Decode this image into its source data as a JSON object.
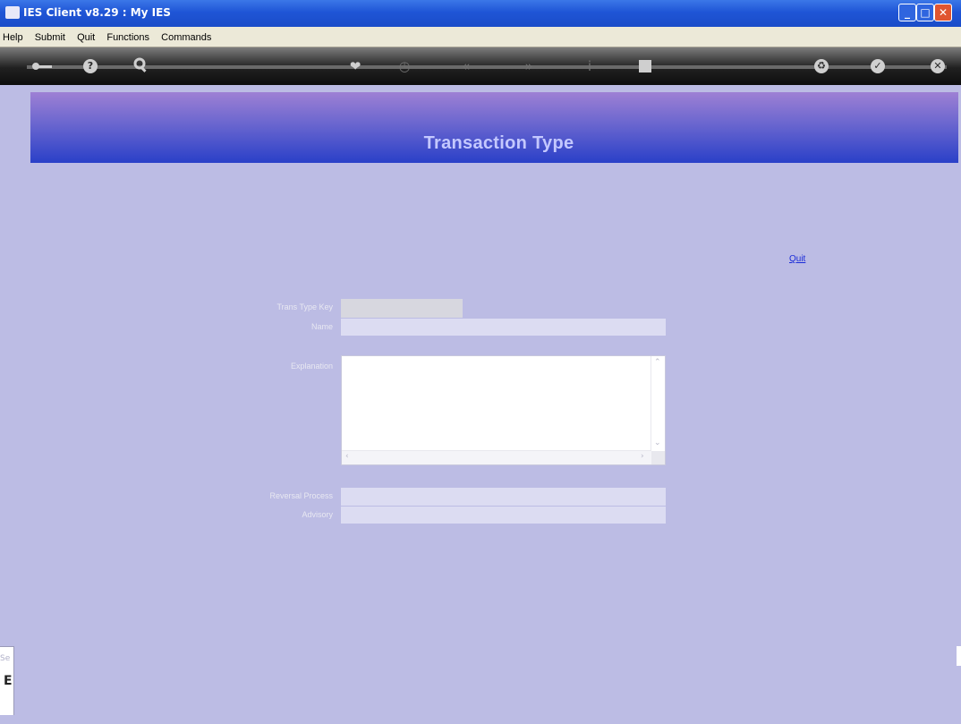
{
  "window": {
    "title": "IES Client v8.29 : My IES",
    "controls": {
      "minimize": "_",
      "maximize": "□",
      "close": "✕"
    }
  },
  "menu": {
    "items": [
      "Help",
      "Submit",
      "Quit",
      "Functions",
      "Commands"
    ]
  },
  "toolbar": {
    "icons": [
      "key-icon",
      "help-icon",
      "search-icon",
      "heart-icon",
      "clock-icon",
      "rewind-icon",
      "fast-forward-icon",
      "info-icon",
      "stop-icon",
      "recycle-icon",
      "check-icon",
      "close-icon"
    ]
  },
  "header": {
    "title": "Transaction Type"
  },
  "actions": {
    "quit_label": "Quit"
  },
  "form": {
    "trans_type_key_label": "Trans Type Key",
    "trans_type_key_value": "",
    "name_label": "Name",
    "name_value": "",
    "explanation_label": "Explanation",
    "explanation_value": "",
    "reversal_process_label": "Reversal Process",
    "reversal_process_value": "",
    "advisory_label": "Advisory",
    "advisory_value": ""
  },
  "side_stub": {
    "text1": "Se",
    "text2": "E"
  },
  "colors": {
    "background": "#bcbce4",
    "banner_top": "#9e80d4",
    "banner_bottom": "#2a40c8",
    "link": "#1a2bd8"
  }
}
